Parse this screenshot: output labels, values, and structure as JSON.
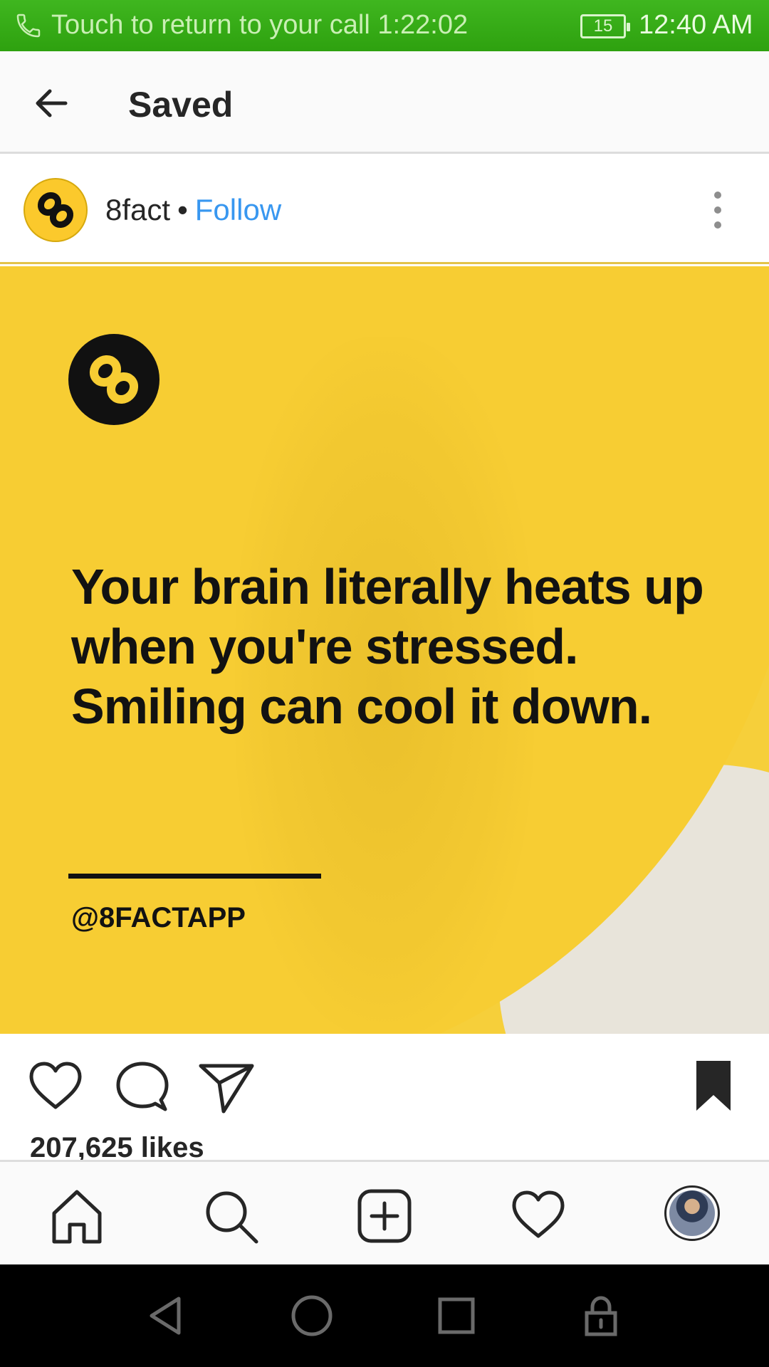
{
  "status_bar": {
    "call_text": "Touch to return to your call",
    "call_timer": "1:22:02",
    "battery": "15",
    "time": "12:40 AM"
  },
  "header": {
    "title": "Saved"
  },
  "post": {
    "username": "8fact",
    "separator": "•",
    "follow_label": "Follow",
    "image_text": "Your brain literally heats up when you're stressed. Smiling can cool it down.",
    "image_handle": "@8FACTAPP",
    "likes": "207,625 likes"
  },
  "icons": {
    "back": "arrow-left-icon",
    "more": "more-vertical-icon",
    "like": "heart-icon",
    "comment": "comment-icon",
    "share": "send-icon",
    "save": "bookmark-icon",
    "home": "home-icon",
    "search": "search-icon",
    "create": "plus-square-icon",
    "activity": "heart-icon",
    "profile": "avatar"
  },
  "colors": {
    "status_bar": "#2ea10f",
    "brand_yellow": "#f7cd33",
    "follow_blue": "#3897f0"
  }
}
